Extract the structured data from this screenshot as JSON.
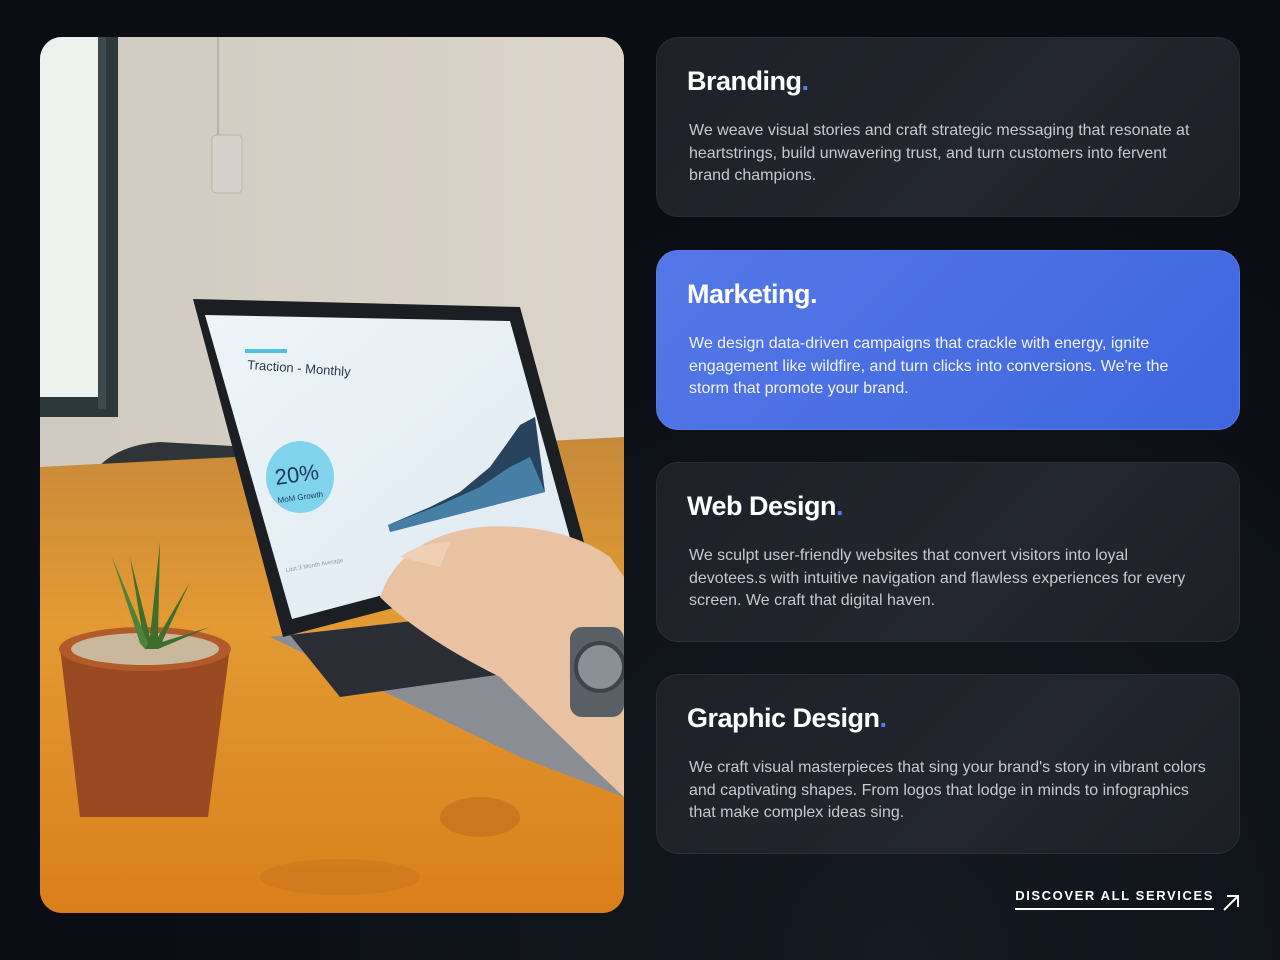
{
  "photo": {
    "alt": "Laptop showing traction chart on wooden table with plant",
    "screen_title": "Traction - Monthly",
    "badge_value": "20%",
    "badge_label": "MoM Growth",
    "footer_note": "Last 3 Month Average"
  },
  "services": [
    {
      "title": "Branding",
      "dot": ".",
      "description": "We weave visual stories and craft strategic messaging that resonate at heartstrings, build unwavering trust, and turn customers into fervent brand champions.",
      "active": false
    },
    {
      "title": "Marketing",
      "dot": ".",
      "description": "We design data-driven campaigns that crackle with energy, ignite engagement like wildfire, and turn clicks into conversions. We're the storm that promote your brand.",
      "active": true
    },
    {
      "title": "Web Design",
      "dot": ".",
      "description": "We sculpt user-friendly websites that convert visitors into loyal devotees.s with intuitive navigation and flawless experiences for every screen. We craft that digital haven.",
      "active": false
    },
    {
      "title": "Graphic Design",
      "dot": ".",
      "description": "We craft visual masterpieces that sing your brand's story in vibrant colors and captivating shapes. From logos that lodge in minds to infographics that make complex ideas sing.",
      "active": false
    }
  ],
  "cta": {
    "label": "DISCOVER ALL SERVICES",
    "icon": "arrow-up-right-icon"
  },
  "colors": {
    "background": "#0a0d13",
    "card": "#1f2229",
    "accent": "#4a6fe3",
    "dot": "#5b7cf0"
  }
}
